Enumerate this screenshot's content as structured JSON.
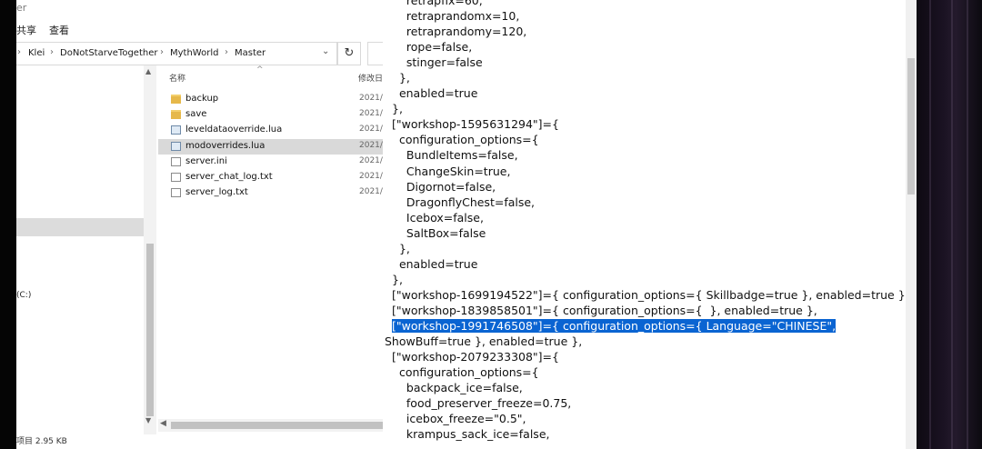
{
  "explorer": {
    "title_fragment": "er",
    "menu": {
      "share": "共享",
      "view": "查看"
    },
    "breadcrumb": [
      "Klei",
      "DoNotStarveTogether",
      "MythWorld",
      "Master"
    ],
    "columns": {
      "name": "名称",
      "modified": "修改日"
    },
    "files": [
      {
        "name": "backup",
        "type": "folder",
        "date": "2021/"
      },
      {
        "name": "save",
        "type": "folder",
        "date": "2021/"
      },
      {
        "name": "leveldataoverride.lua",
        "type": "lua",
        "date": "2021/"
      },
      {
        "name": "modoverrides.lua",
        "type": "lua",
        "date": "2021/",
        "selected": true
      },
      {
        "name": "server.ini",
        "type": "doc",
        "date": "2021/"
      },
      {
        "name": "server_chat_log.txt",
        "type": "doc",
        "date": "2021/"
      },
      {
        "name": "server_log.txt",
        "type": "doc",
        "date": "2021/"
      }
    ],
    "nav": {
      "drive": "(C:)",
      "small1": "",
      "small2": ""
    },
    "status": "项目  2.95 KB"
  },
  "editor": {
    "lines": [
      {
        "text": "    retrapfix=60,"
      },
      {
        "text": "    retraprandomx=10,"
      },
      {
        "text": "    retraprandomy=120,"
      },
      {
        "text": "    rope=false,"
      },
      {
        "text": "    stinger=false"
      },
      {
        "text": "  },"
      },
      {
        "text": "  enabled=true"
      },
      {
        "text": "},"
      },
      {
        "text": "[\"workshop-1595631294\"]={"
      },
      {
        "text": "  configuration_options={"
      },
      {
        "text": "    BundleItems=false,"
      },
      {
        "text": "    ChangeSkin=true,"
      },
      {
        "text": "    Digornot=false,"
      },
      {
        "text": "    DragonflyChest=false,"
      },
      {
        "text": "    Icebox=false,"
      },
      {
        "text": "    SaltBox=false"
      },
      {
        "text": "  },"
      },
      {
        "text": "  enabled=true"
      },
      {
        "text": "},"
      },
      {
        "text": "[\"workshop-1699194522\"]={ configuration_options={ Skillbadge=true }, enabled=true },"
      },
      {
        "text": "[\"workshop-1839858501\"]={ configuration_options={  }, enabled=true },"
      },
      {
        "text": "[\"workshop-1991746508\"]={ configuration_options={ Language=\"CHINESE\",",
        "highlight": true
      },
      {
        "text": "ShowBuff=true }, enabled=true },",
        "outdent": true
      },
      {
        "text": "[\"workshop-2079233308\"]={"
      },
      {
        "text": "  configuration_options={"
      },
      {
        "text": "    backpack_ice=false,"
      },
      {
        "text": "    food_preserver_freeze=0.75,"
      },
      {
        "text": "    icebox_freeze=\"0.5\","
      },
      {
        "text": "    krampus_sack_ice=false,"
      }
    ]
  }
}
